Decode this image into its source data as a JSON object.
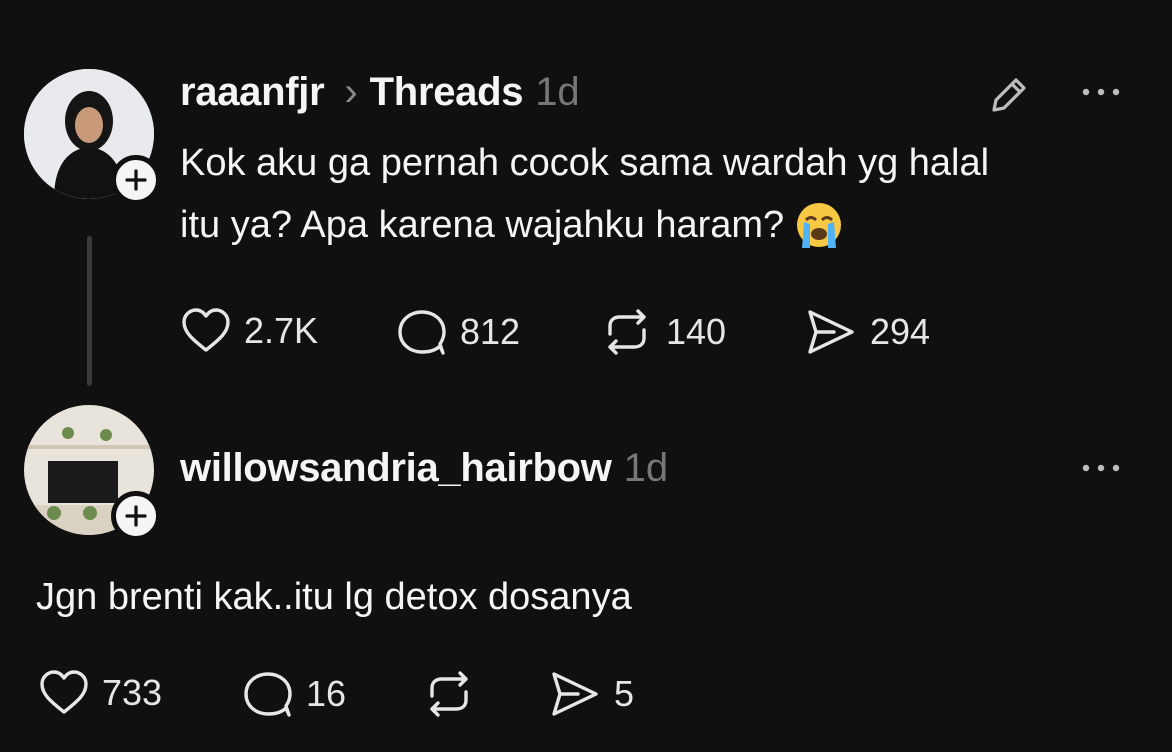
{
  "post": {
    "username": "raaanfjr",
    "breadcrumb_separator": "›",
    "topic": "Threads",
    "time": "1d",
    "text_line1": "Kok aku ga pernah cocok sama wardah yg halal",
    "text_line2": "itu ya? Apa karena wajahku haram?",
    "emoji": "loudly-crying-face",
    "stats": {
      "likes": "2.7K",
      "replies": "812",
      "reposts": "140",
      "shares": "294"
    }
  },
  "reply": {
    "username": "willowsandria_hairbow",
    "time": "1d",
    "text": "Jgn brenti kak..itu lg detox dosanya",
    "stats": {
      "likes": "733",
      "replies": "16",
      "shares": "5"
    }
  },
  "colors": {
    "background": "#101010",
    "text": "#f3f5f7",
    "muted": "#777777",
    "thread_line": "#3a3a3a"
  }
}
